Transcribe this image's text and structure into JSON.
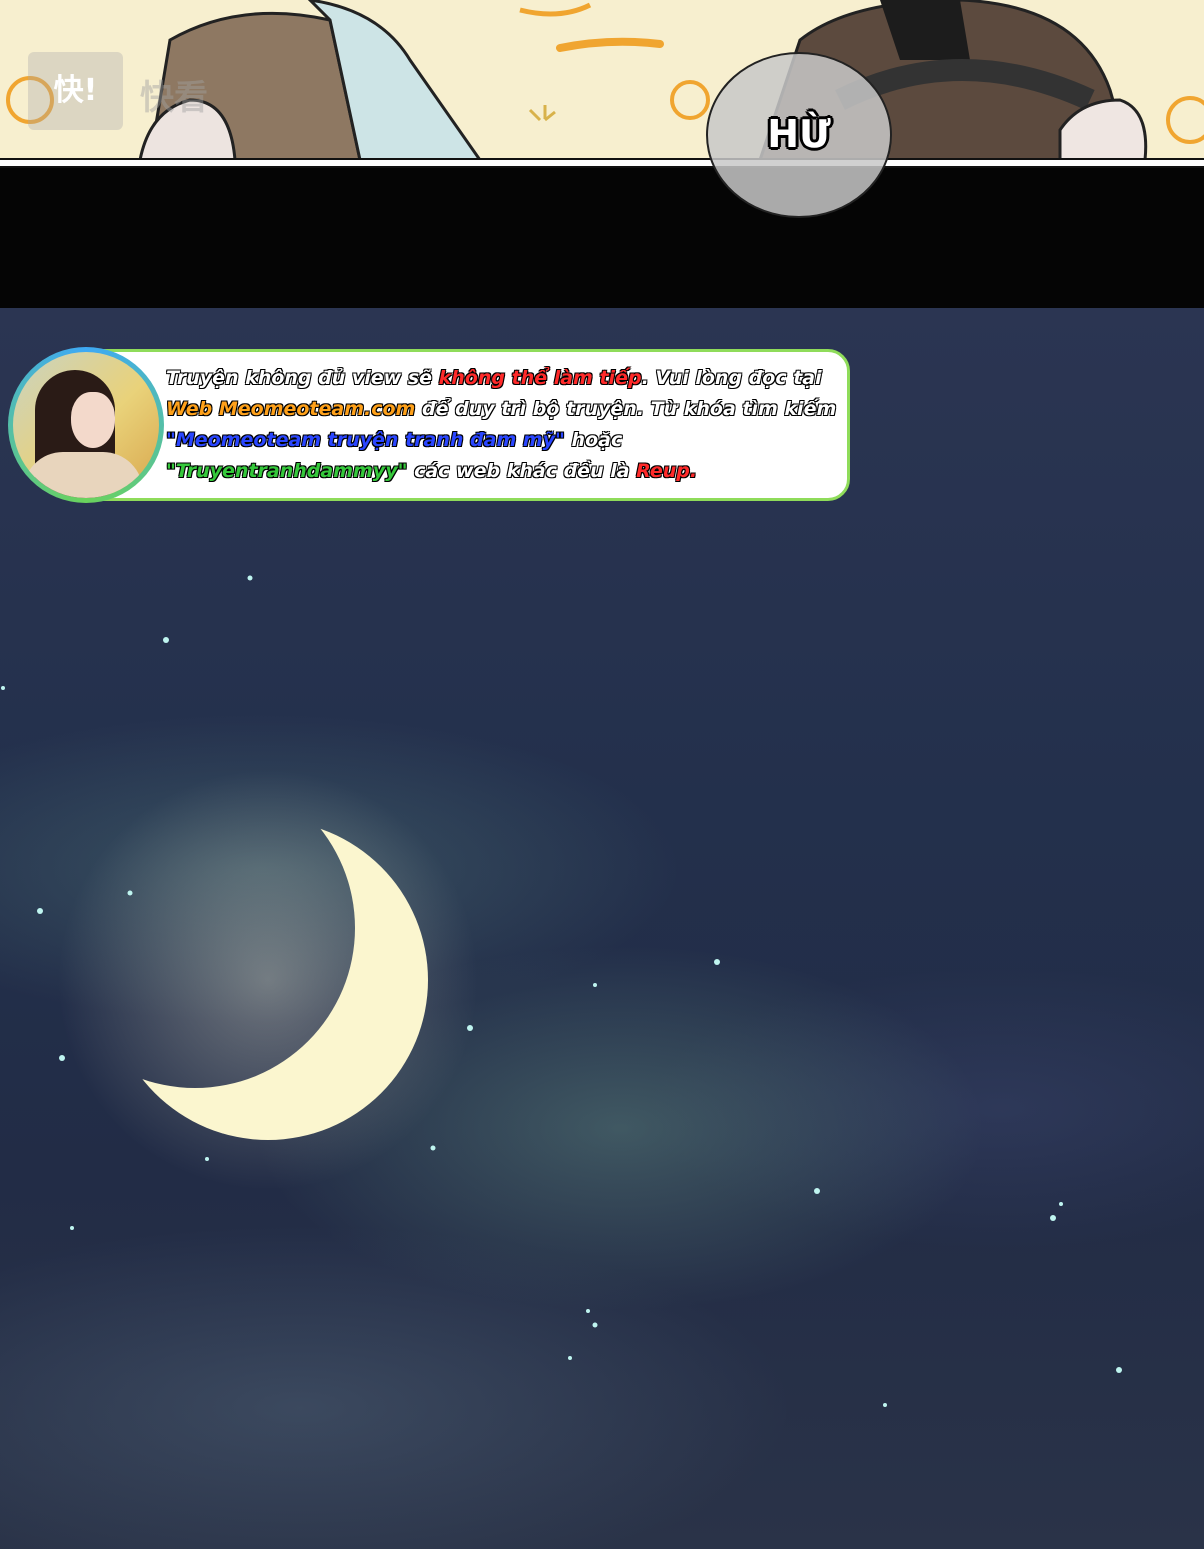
{
  "panel": {
    "watermark_logo": "快!",
    "watermark_text": "快看",
    "speech_bubble": "HỪ"
  },
  "notice": {
    "line1": [
      {
        "text": "Truyện không đủ view sẽ ",
        "color": "white"
      },
      {
        "text": "không thể làm tiếp",
        "color": "red"
      },
      {
        "text": ". Vui lòng đọc tại",
        "color": "white"
      }
    ],
    "line2": [
      {
        "text": "Web Meomeoteam.com",
        "color": "orange"
      },
      {
        "text": " để duy trì bộ truyện. Từ khóa tìm kiếm",
        "color": "white"
      }
    ],
    "line3": [
      {
        "text": "\"Meomeoteam truyện tranh đam mỹ\"",
        "color": "blue"
      },
      {
        "text": " hoặc",
        "color": "white"
      }
    ],
    "line4": [
      {
        "text": "\"Truyentranhdammyy\"",
        "color": "green"
      },
      {
        "text": " các web khác đều là ",
        "color": "white"
      },
      {
        "text": "Reup.",
        "color": "red"
      }
    ]
  },
  "colors": {
    "accent_green": "#8fdc5a",
    "sky": "#23304c",
    "moon": "#fbf6cf"
  }
}
